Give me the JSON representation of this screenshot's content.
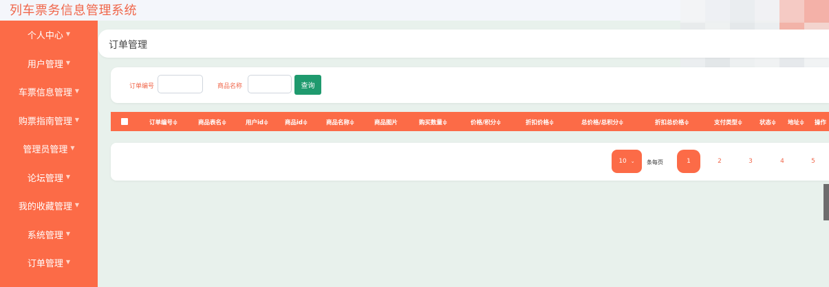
{
  "header": {
    "app_title": "列车票务信息管理系统"
  },
  "sidebar": {
    "items": [
      {
        "label": "个人中心"
      },
      {
        "label": "用户管理"
      },
      {
        "label": "车票信息管理"
      },
      {
        "label": "购票指南管理"
      },
      {
        "label": "管理员管理"
      },
      {
        "label": "论坛管理"
      },
      {
        "label": "我的收藏管理"
      },
      {
        "label": "系统管理"
      },
      {
        "label": "订单管理"
      }
    ]
  },
  "breadcrumb": {
    "title": "订单管理"
  },
  "search": {
    "order_no_label": "订单编号",
    "order_no_value": "",
    "product_name_label": "商品名称",
    "product_name_value": "",
    "query_button": "查询"
  },
  "table": {
    "columns": [
      "订单编号≑",
      "商品表名≑",
      "用户id≑",
      "商品id≑",
      "商品名称≑",
      "商品图片",
      "购买数量≑",
      "价格/积分≑",
      "折扣价格≑",
      "总价格/总积分≑",
      "折扣总价格≑",
      "支付类型≑",
      "状态≑",
      "地址≑",
      "操作"
    ],
    "rows": []
  },
  "pagination": {
    "page_size": "10",
    "page_size_suffix": "条每页",
    "pages": [
      "1",
      "2",
      "3",
      "4",
      "5"
    ],
    "current_page": "1"
  },
  "colors": {
    "accent": "#fc6b47",
    "query_button": "#1f9a6e",
    "background": "#e8f1ec"
  }
}
